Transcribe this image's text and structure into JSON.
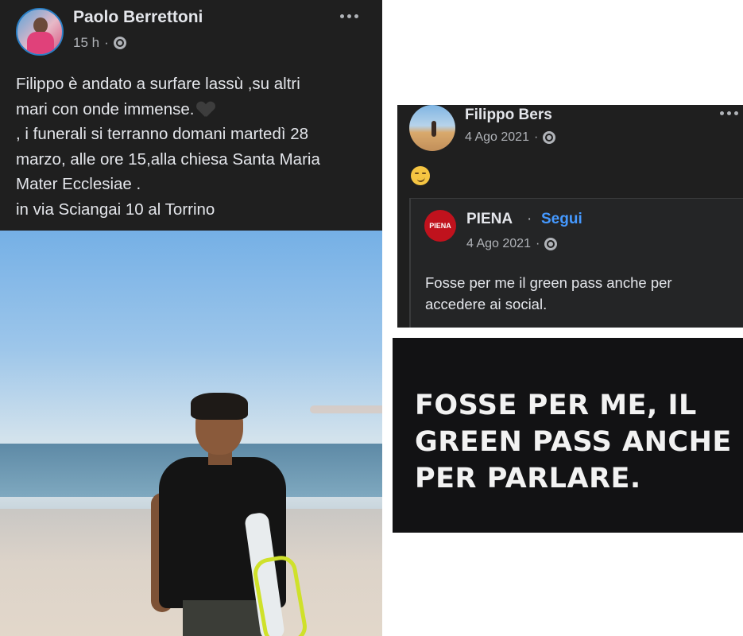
{
  "left_post": {
    "author": "Paolo Berrettoni",
    "time": "15 h",
    "separator": "·",
    "text_line1": "Filippo è andato a surfare lassù ,su altri",
    "text_line2": "mari con onde immense.",
    "text_rest": ", i funerali si terranno domani martedì 28\nmarzo, alle ore 15,alla chiesa Santa Maria\nMater Ecclesiae .\nin via Sciangai 10 al Torrino",
    "icons": [
      "avatar",
      "globe-icon",
      "more-icon",
      "black-heart-emoji"
    ]
  },
  "right_post": {
    "author": "Filippo Bers",
    "date": "4 Ago 2021",
    "separator": "·",
    "icons": [
      "avatar",
      "globe-icon",
      "more-icon",
      "smirk-emoji"
    ],
    "shared": {
      "page_name": "PIENA",
      "dot": "·",
      "follow": "Segui",
      "date": "4 Ago 2021",
      "separator": "·",
      "logo_text": "PIENA",
      "text": "Fosse per me il green pass anche per accedere ai social."
    }
  },
  "banner": {
    "line1": "FOSSE PER ME, IL",
    "line2": "GREEN PASS ANCHE",
    "line3": "PER PARLARE."
  }
}
